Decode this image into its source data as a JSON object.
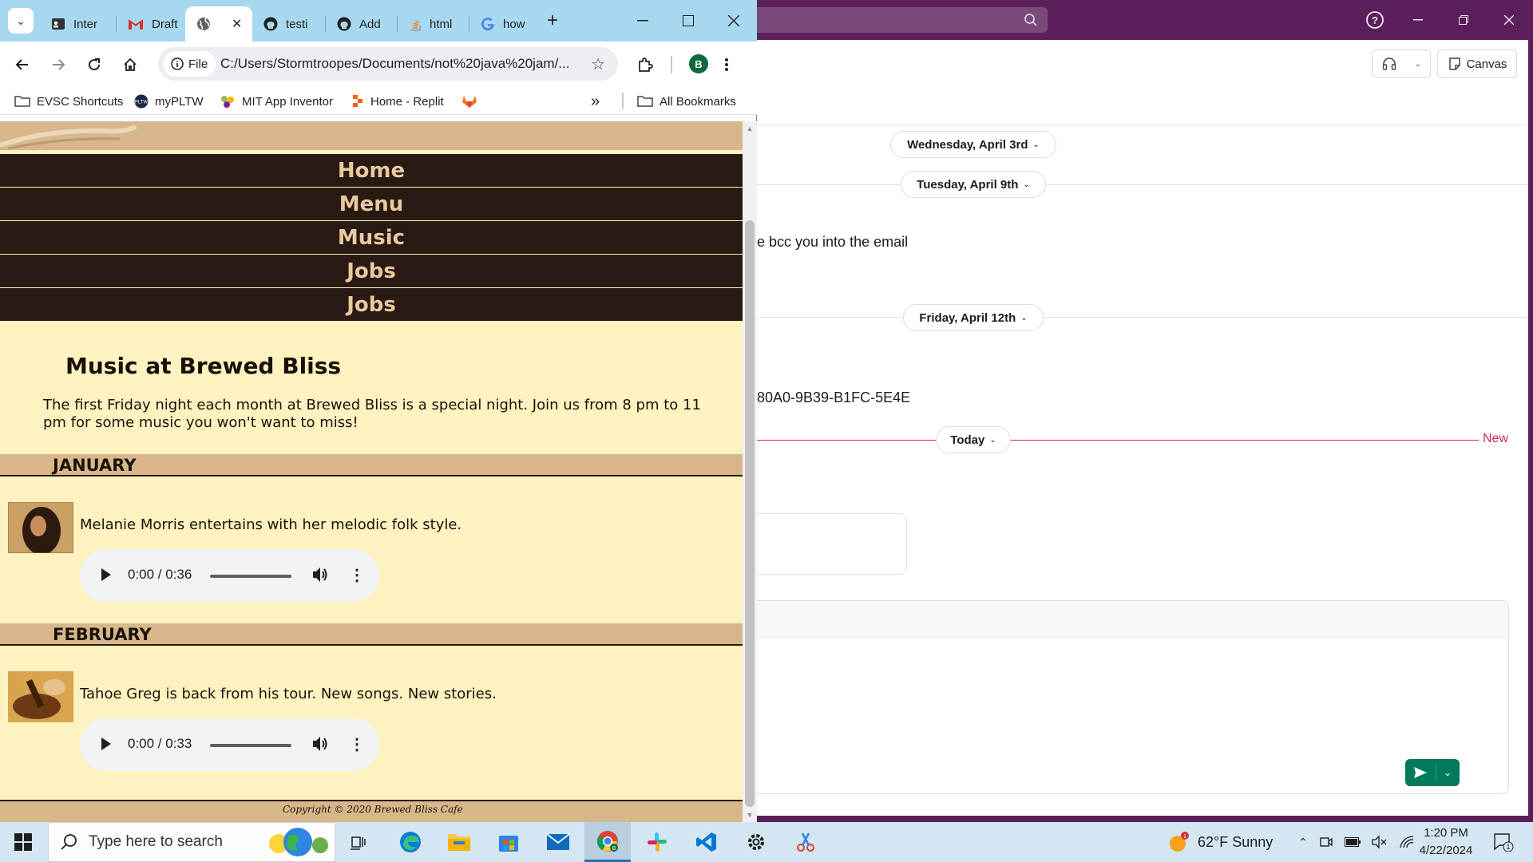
{
  "slack": {
    "header_buttons": {
      "canvas_label": "Canvas"
    },
    "day_dividers": [
      "Wednesday, April 3rd",
      "Tuesday, April 9th",
      "Friday, April 12th",
      "Today"
    ],
    "messages": [
      "e bcc you into the email",
      "80A0-9B39-B1FC-5E4E"
    ],
    "new_label": "New",
    "colors": {
      "sidebar": "#5b1f5b",
      "new_divider": "#e01e5a",
      "send": "#007a5a"
    }
  },
  "chrome": {
    "tabs": [
      {
        "title": "Inter",
        "icon": "id-card-icon"
      },
      {
        "title": "Draft",
        "icon": "gmail-icon"
      },
      {
        "title": "",
        "icon": "globe-icon",
        "active": true
      },
      {
        "title": "testi",
        "icon": "github-icon"
      },
      {
        "title": "Add",
        "icon": "github-icon"
      },
      {
        "title": "html",
        "icon": "stack-icon"
      },
      {
        "title": "how",
        "icon": "google-icon"
      }
    ],
    "address": {
      "chip_label": "File",
      "url": "C:/Users/Stormtroopes/Documents/not%20java%20jam/..."
    },
    "profile_initial": "B",
    "bookmarks": [
      "EVSC Shortcuts",
      "myPLTW",
      "MIT App Inventor",
      "Home - Replit"
    ],
    "all_bookmarks_label": "All Bookmarks"
  },
  "page": {
    "nav": [
      "Home",
      "Menu",
      "Music",
      "Jobs",
      "Jobs"
    ],
    "title": "Music at Brewed Bliss",
    "intro": "The first Friday night each month at Brewed Bliss is a special night. Join us from 8 pm to 11 pm for some music you won't want to miss!",
    "months": [
      {
        "name": "JANUARY",
        "text": "Melanie Morris entertains with her melodic folk style.",
        "time": "0:00 / 0:36"
      },
      {
        "name": "FEBRUARY",
        "text": "Tahoe Greg is back from his tour. New songs. New stories.",
        "time": "0:00 / 0:33"
      }
    ],
    "footer": "Copyright © 2020 Brewed Bliss Cafe"
  },
  "taskbar": {
    "search_placeholder": "Type here to search",
    "weather": "62°F  Sunny",
    "time": "1:20 PM",
    "date": "4/22/2024",
    "notification_count": "1",
    "weather_badge": "1"
  }
}
